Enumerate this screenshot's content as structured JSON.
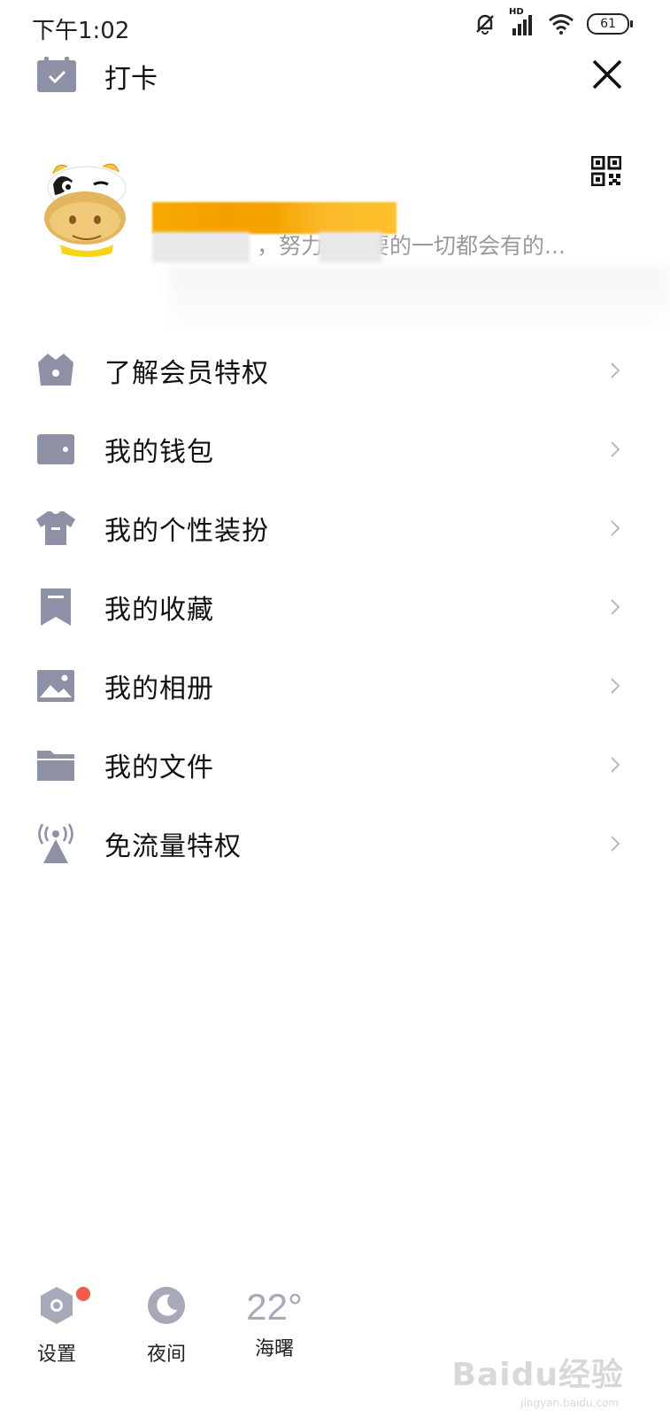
{
  "status_bar": {
    "time": "下午1:02",
    "battery": "61",
    "hd_label": "HD"
  },
  "header": {
    "checkin_label": "打卡"
  },
  "profile": {
    "signature": "，努力…想要的一切都会有的..."
  },
  "menu": [
    {
      "label": "了解会员特权",
      "icon": "crown-icon"
    },
    {
      "label": "我的钱包",
      "icon": "wallet-icon"
    },
    {
      "label": "我的个性装扮",
      "icon": "shirt-icon"
    },
    {
      "label": "我的收藏",
      "icon": "bookmark-icon"
    },
    {
      "label": "我的相册",
      "icon": "image-icon"
    },
    {
      "label": "我的文件",
      "icon": "folder-icon"
    },
    {
      "label": "免流量特权",
      "icon": "signal-tower-icon"
    }
  ],
  "bottom_bar": {
    "settings_label": "设置",
    "night_label": "夜间",
    "weather_temp": "22°",
    "weather_city": "海曙"
  },
  "watermark": {
    "text": "Baidu经验",
    "sub": "jingyan.baidu.com"
  },
  "colors": {
    "icon_gray": "#8e90a6",
    "badge_red": "#f25a4a",
    "name_orange": "#f7a900"
  }
}
